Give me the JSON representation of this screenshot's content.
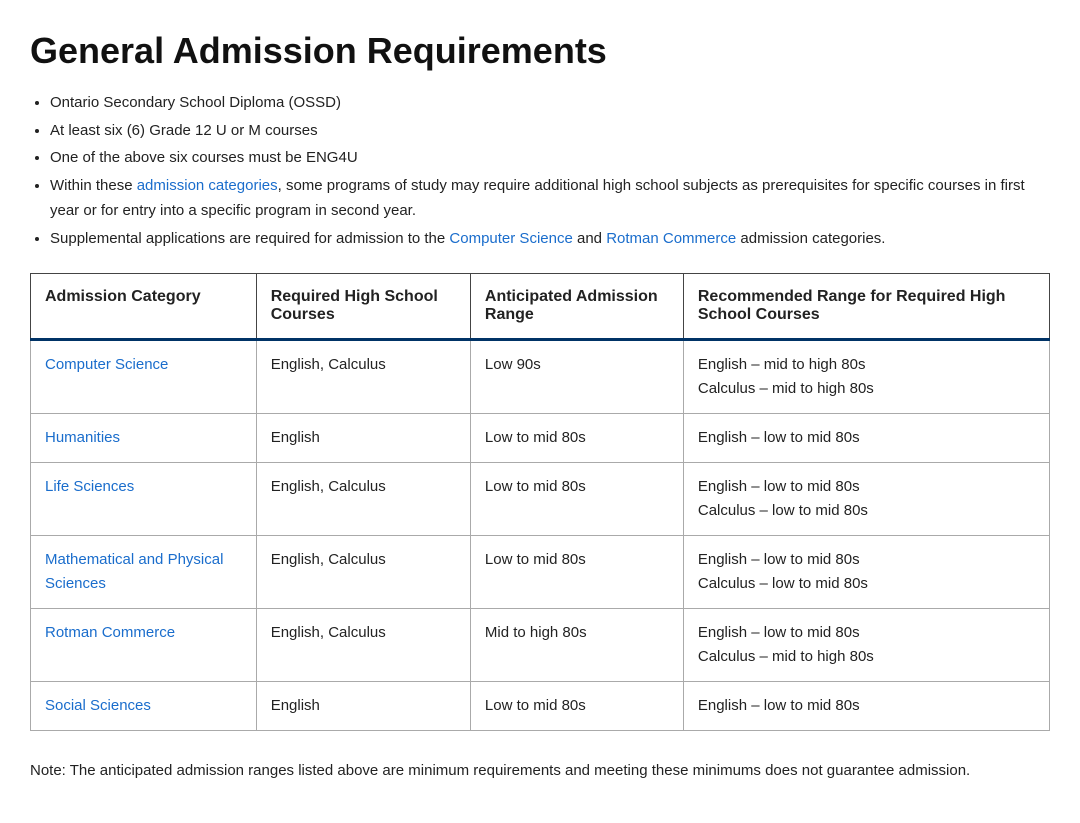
{
  "page": {
    "title": "General Admission Requirements",
    "bullets": [
      "Ontario Secondary School Diploma (OSSD)",
      "At least six (6) Grade 12 U or M courses",
      "One of the above six courses must be ENG4U",
      "Within these <a-admission> admission categories </a-admission>, some programs of study may require additional high school subjects as prerequisites for specific courses in first year or for entry into a specific program in second year.",
      "Supplemental applications are required for admission to the <a-cs> Computer Science </a-cs> and <a-rc> Rotman Commerce </a-rc> admission categories."
    ],
    "bullet_plain": [
      "Ontario Secondary School Diploma (OSSD)",
      "At least six (6) Grade 12 U or M courses",
      "One of the above six courses must be ENG4U"
    ],
    "bullet4_before": "Within these ",
    "bullet4_link1_text": "admission categories",
    "bullet4_link1_href": "#",
    "bullet4_after": ", some programs of study may require additional high school subjects as prerequisites for specific courses in first year or for entry into a specific program in second year.",
    "bullet5_before": "Supplemental applications are required for admission to the ",
    "bullet5_link1_text": "Computer Science",
    "bullet5_link1_href": "#",
    "bullet5_mid": " and ",
    "bullet5_link2_text": "Rotman Commerce",
    "bullet5_link2_href": "#",
    "bullet5_after": " admission categories.",
    "table": {
      "headers": [
        "Admission Category",
        "Required High School Courses",
        "Anticipated Admission Range",
        "Recommended Range for Required High School Courses"
      ],
      "rows": [
        {
          "category": "Computer Science",
          "category_href": "#",
          "courses": "English, Calculus",
          "range": "Low 90s",
          "recommended": "English – mid to high 80s\nCalculus – mid to high 80s"
        },
        {
          "category": "Humanities",
          "category_href": "#",
          "courses": "English",
          "range": "Low to mid 80s",
          "recommended": "English – low to mid 80s"
        },
        {
          "category": "Life Sciences",
          "category_href": "#",
          "courses": "English, Calculus",
          "range": "Low to mid 80s",
          "recommended": "English – low to mid 80s\nCalculus – low to mid 80s"
        },
        {
          "category": "Mathematical and Physical Sciences",
          "category_href": "#",
          "courses": "English, Calculus",
          "range": "Low to mid 80s",
          "recommended": "English – low to mid 80s\nCalculus – low to mid 80s"
        },
        {
          "category": "Rotman Commerce",
          "category_href": "#",
          "courses": "English, Calculus",
          "range": "Mid to high 80s",
          "recommended": "English – low to mid 80s\nCalculus – mid to high 80s"
        },
        {
          "category": "Social Sciences",
          "category_href": "#",
          "courses": "English",
          "range": "Low to mid 80s",
          "recommended": "English – low to mid 80s"
        }
      ]
    },
    "note": "Note: The anticipated admission ranges listed above are minimum requirements and meeting these minimums does not guarantee admission."
  }
}
